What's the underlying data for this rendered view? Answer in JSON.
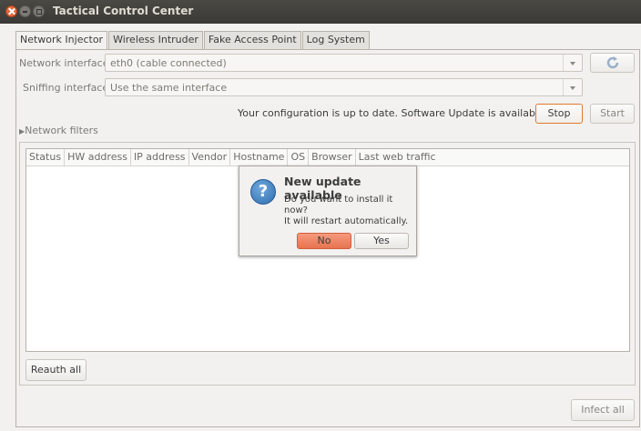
{
  "window": {
    "title": "Tactical Control Center"
  },
  "tabs": [
    "Network Injector",
    "Wireless Intruder",
    "Fake Access Point",
    "Log System"
  ],
  "form": {
    "network_interface_label": "Network interface:",
    "network_interface_value": "eth0 (cable connected)",
    "sniffing_interface_label": "Sniffing interface:",
    "sniffing_interface_value": "Use the same interface"
  },
  "status_text": "Your configuration is up to date. Software Update is available.",
  "buttons": {
    "stop": "Stop",
    "start": "Start",
    "reauth_all": "Reauth all",
    "infect_all": "Infect all"
  },
  "filters_label": "Network filters",
  "table": {
    "columns": [
      "Status",
      "HW address",
      "IP address",
      "Vendor",
      "Hostname",
      "OS",
      "Browser",
      "Last web traffic"
    ]
  },
  "dialog": {
    "title": "New update available",
    "line1": "Do you want to install it now?",
    "line2": "It will restart automatically.",
    "no_label": "No",
    "yes_label": "Yes",
    "icon": "question-icon"
  }
}
